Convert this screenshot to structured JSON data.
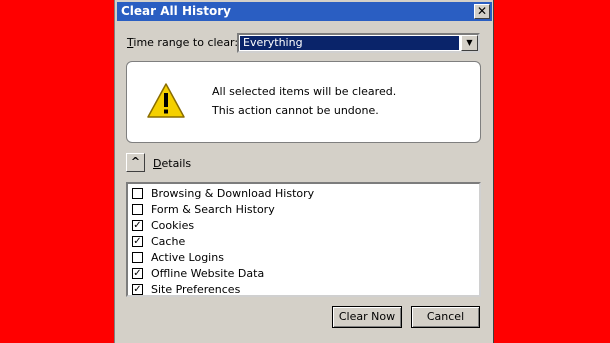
{
  "dialog": {
    "title": "Clear All History",
    "close_glyph": "✕"
  },
  "time_range": {
    "label": "Time range to clear:",
    "selected": "Everything"
  },
  "warning": {
    "icon": "warning-icon",
    "line1": "All selected items will be cleared.",
    "line2": "This action cannot be undone."
  },
  "details": {
    "toggle_glyph": "^",
    "label": "Details",
    "items": [
      {
        "label": "Browsing & Download History",
        "checked": false
      },
      {
        "label": "Form & Search History",
        "checked": false
      },
      {
        "label": "Cookies",
        "checked": true
      },
      {
        "label": "Cache",
        "checked": true
      },
      {
        "label": "Active Logins",
        "checked": false
      },
      {
        "label": "Offline Website Data",
        "checked": true
      },
      {
        "label": "Site Preferences",
        "checked": true
      }
    ]
  },
  "buttons": {
    "clear_now": "Clear Now",
    "cancel": "Cancel"
  },
  "colors": {
    "background": "#ff0000",
    "titlebar": "#2a5ec2",
    "selection": "#0a246a"
  }
}
